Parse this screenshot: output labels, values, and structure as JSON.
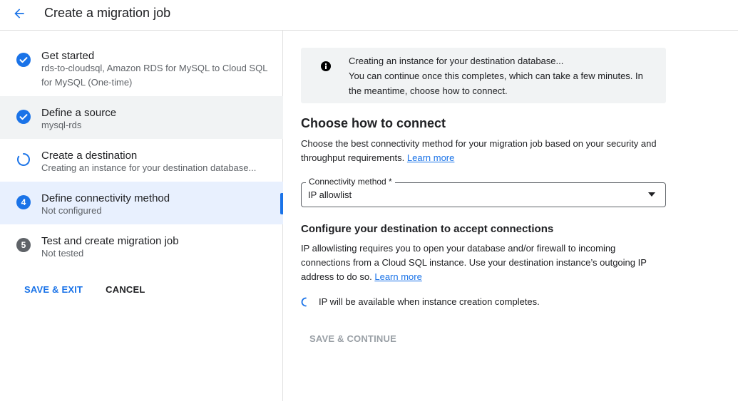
{
  "header": {
    "back_icon": "arrow-back-icon",
    "title": "Create a migration job"
  },
  "colors": {
    "accent": "#1a73e8",
    "active_step_bg": "#e8f0fe",
    "shaded_step_bg": "#f1f3f4",
    "disabled_text": "#9aa0a6"
  },
  "sidebar": {
    "steps": [
      {
        "title": "Get started",
        "status": "complete",
        "icon": "check-circle-icon",
        "subtitle": "rds-to-cloudsql, Amazon RDS for MySQL to Cloud SQL for MySQL (One-time)"
      },
      {
        "title": "Define a source",
        "status": "complete",
        "icon": "check-circle-icon",
        "subtitle": "mysql-rds"
      },
      {
        "title": "Create a destination",
        "status": "in-progress",
        "icon": "progress-spinner-icon",
        "subtitle": "Creating an instance for your destination database..."
      },
      {
        "title": "Define connectivity method",
        "status": "active",
        "number": "4",
        "subtitle": "Not configured"
      },
      {
        "title": "Test and create migration job",
        "status": "pending",
        "number": "5",
        "subtitle": "Not tested"
      }
    ],
    "save_exit_label": "SAVE & EXIT",
    "cancel_label": "CANCEL"
  },
  "main": {
    "info": {
      "icon": "info-icon",
      "line1": "Creating an instance for your destination database...",
      "line2": "You can continue once this completes, which can take a few minutes. In the meantime, choose how to connect."
    },
    "connect_heading": "Choose how to connect",
    "connect_desc": "Choose the best connectivity method for your migration job based on your security and throughput requirements.",
    "learn_more_1": "Learn more",
    "connectivity": {
      "label": "Connectivity method *",
      "value": "IP allowlist"
    },
    "configure_heading": "Configure your destination to accept connections",
    "configure_desc": "IP allowlisting requires you to open your database and/or firewall to incoming connections from a Cloud SQL instance. Use your destination instance’s outgoing IP address to do so.",
    "learn_more_2": "Learn more",
    "ip_status": "IP will be available when instance creation completes.",
    "save_continue_label": "SAVE & CONTINUE"
  }
}
